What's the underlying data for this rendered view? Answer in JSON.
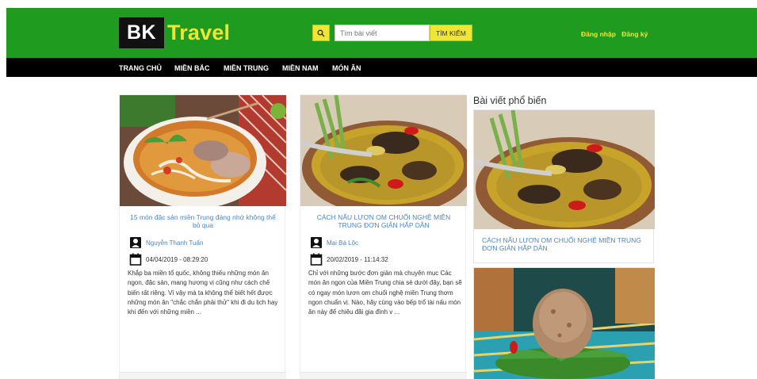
{
  "brand": {
    "logo_bk": "BK",
    "logo_travel": "Travel"
  },
  "search": {
    "placeholder": "Tìm bài viết",
    "submit_label": "TÌM KIẾM",
    "icon": "search-icon"
  },
  "auth": {
    "login": "Đăng nhập",
    "register": "Đăng ký"
  },
  "nav": {
    "items": [
      "TRANG CHỦ",
      "MIỀN BẮC",
      "MIỀN TRUNG",
      "MIỀN NAM",
      "MÓN ĂN"
    ]
  },
  "colors": {
    "header_green": "#1f9b1f",
    "accent_yellow": "#f0e535",
    "link_blue": "#4a86c7",
    "nav_black": "#000000"
  },
  "posts": [
    {
      "title": "15 món đặc sản miền Trung đáng nhớ không thể bỏ qua",
      "author": "Nguyễn Thanh Tuấn",
      "date": "04/04/2019 - 08:29:20",
      "excerpt": "Khắp ba miền tổ quốc, không thiếu những món ăn ngon, đặc sản, mang hương vị cũng như cách chế biến rất riêng. Vì vậy mà ta không thể biết hết được những món ăn \"chắc chắn phải thử\" khi đi du lịch hay khi đến với những miền ..."
    },
    {
      "title": "CÁCH NẤU LƯƠN OM CHUỐI NGHỆ MIỀN TRUNG ĐƠN GIẢN HẤP DẪN",
      "author": "Mai Bá Lộc",
      "date": "20/02/2019 - 11:14:32",
      "excerpt": "Chỉ với những bước đơn giản mà chuyên mục Các món ăn ngon của Miền Trung chia sẻ dưới đây, bạn sẽ có ngay món lươn om chuối nghệ miền Trung thơm ngon chuẩn vị. Nào, hãy cùng vào bếp trổ tài nấu món ăn này để chiêu đãi gia đình v ..."
    }
  ],
  "sidebar": {
    "title": "Bài viết phổ biến",
    "items": [
      {
        "title": "CÁCH NẤU LƯƠN OM CHUỐI NGHỆ MIỀN TRUNG ĐƠN GIẢN HẤP DẪN"
      }
    ]
  }
}
